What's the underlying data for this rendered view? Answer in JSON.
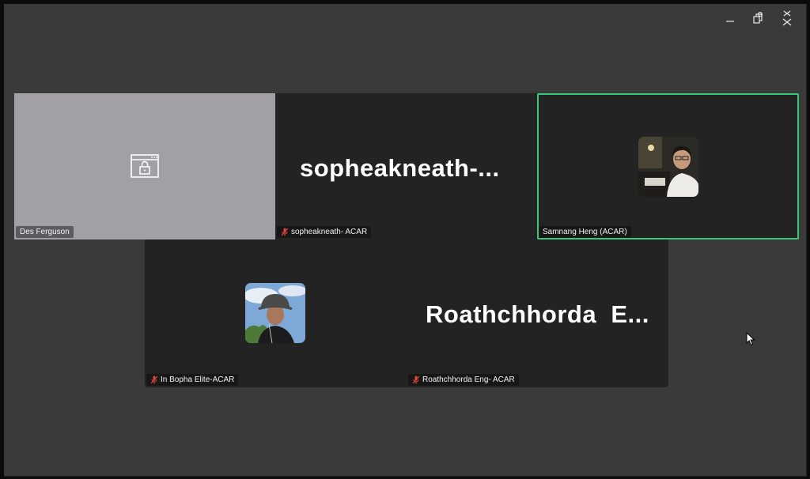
{
  "window_controls": {
    "minimize": "minimize-icon",
    "restore": "restore-icon",
    "close": "close-icon"
  },
  "participants": [
    {
      "name": "Des Ferguson",
      "video": "off-locked",
      "muted": false
    },
    {
      "name": "sopheakneath- ACAR",
      "display_name": "sopheakneath-...",
      "muted": true
    },
    {
      "name": "Samnang Heng (ACAR)",
      "video": "avatar",
      "muted": false,
      "active_speaker": true
    },
    {
      "name": "In Bopha Elite-ACAR",
      "video": "avatar",
      "muted": true
    },
    {
      "name": "Roathchhorda Eng- ACAR",
      "display_name": "Roathchhorda  E...",
      "muted": true
    }
  ],
  "colors": {
    "active_speaker_border": "#35c97a",
    "mute_icon": "#e0443a",
    "background": "#3a3a3a",
    "tile": "#232323"
  }
}
